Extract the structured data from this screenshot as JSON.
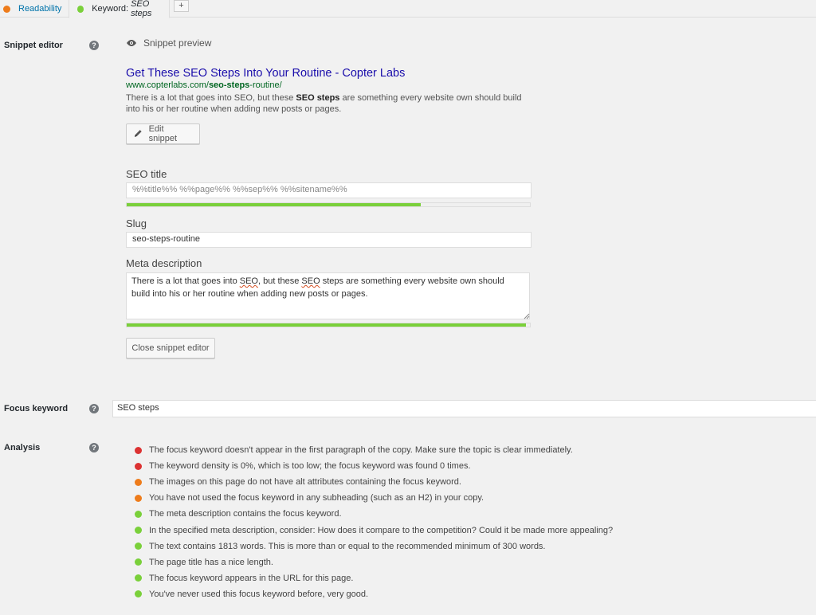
{
  "colors": {
    "good": "#7ad03a",
    "ok": "#ee7c1b",
    "bad": "#dc3232",
    "link": "#1a0dab",
    "url": "#006621"
  },
  "tabs": {
    "readability": {
      "label": "Readability",
      "status": "ok"
    },
    "keyword": {
      "prefix": "Keyword:",
      "value": "SEO steps",
      "status": "good"
    },
    "add_label": "+"
  },
  "snippet_editor": {
    "label": "Snippet editor",
    "help_icon": "?",
    "preview_label": "Snippet preview",
    "preview_icon": "eye-icon",
    "title": "Get These SEO Steps Into Your Routine - Copter Labs",
    "url_prefix": "www.copterlabs.com/",
    "url_bold": "seo-steps",
    "url_suffix": "-routine/",
    "desc_part1": "There is a lot that goes into SEO, but these ",
    "desc_bold": "SEO steps",
    "desc_part2": " are something every website own should build into his or her routine when adding new posts or pages.",
    "edit_button": "Edit snippet",
    "edit_icon": "pencil-icon",
    "seo_title_label": "SEO title",
    "seo_title_value": "%%title%% %%page%% %%sep%% %%sitename%%",
    "seo_title_progress": 0.73,
    "slug_label": "Slug",
    "slug_value": "seo-steps-routine",
    "meta_label": "Meta description",
    "meta_parts": [
      "There is a lot that goes into ",
      "SEO",
      ", but these ",
      "SEO",
      " steps are something every website own should build into his or her routine when adding new posts or pages."
    ],
    "meta_progress": 0.99,
    "close_button": "Close snippet editor"
  },
  "focus_keyword": {
    "label": "Focus keyword",
    "help_icon": "?",
    "value": "SEO steps"
  },
  "analysis": {
    "label": "Analysis",
    "help_icon": "?",
    "items": [
      {
        "status": "bad",
        "text": "The focus keyword doesn't appear in the first paragraph of the copy. Make sure the topic is clear immediately."
      },
      {
        "status": "bad",
        "text": "The keyword density is 0%, which is too low; the focus keyword was found 0 times."
      },
      {
        "status": "ok",
        "text": "The images on this page do not have alt attributes containing the focus keyword."
      },
      {
        "status": "ok",
        "text": "You have not used the focus keyword in any subheading (such as an H2) in your copy."
      },
      {
        "status": "good",
        "text": "The meta description contains the focus keyword."
      },
      {
        "status": "good",
        "text": "In the specified meta description, consider: How does it compare to the competition? Could it be made more appealing?"
      },
      {
        "status": "good",
        "text": "The text contains 1813 words. This is more than or equal to the recommended minimum of 300 words."
      },
      {
        "status": "good",
        "text": "The page title has a nice length."
      },
      {
        "status": "good",
        "text": "The focus keyword appears in the URL for this page."
      },
      {
        "status": "good",
        "text": "You've never used this focus keyword before, very good."
      }
    ]
  }
}
